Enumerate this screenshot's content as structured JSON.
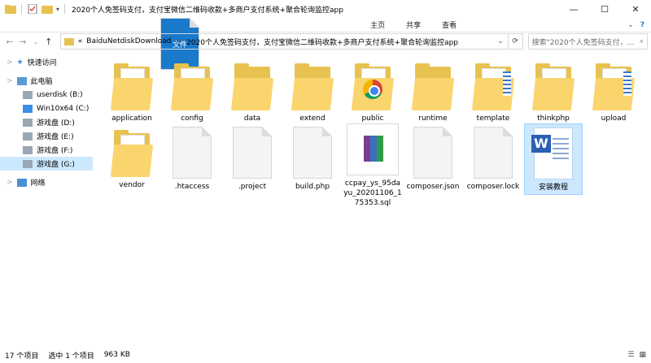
{
  "window": {
    "title": "2020个人免签码支付，支付宝微信二维码收款+多商户支付系统+聚合轮询监控app",
    "minimize_glyph": "—",
    "maximize_glyph": "☐",
    "close_glyph": "✕"
  },
  "ribbon": {
    "tabs": [
      "文件",
      "主页",
      "共享",
      "查看"
    ],
    "expand_glyph": "⌄",
    "help_glyph": "?"
  },
  "address": {
    "back_glyph": "←",
    "forward_glyph": "→",
    "recent_glyph": "⌄",
    "up_glyph": "↑",
    "overflow": "«",
    "crumbs": [
      "BaiduNetdiskDownload",
      "2020个人免签码支付，支付宝微信二维码收款+多商户支付系统+聚合轮询监控app"
    ],
    "separator": ">",
    "dropdown_glyph": "⌄",
    "refresh_glyph": "⟳",
    "search_placeholder": "搜索\"2020个人免签码支付，...",
    "search_glyph": "⌕"
  },
  "sidebar": {
    "items": [
      {
        "label": "快速访问",
        "icon": "star-icon"
      },
      {
        "label": "此电脑",
        "icon": "computer-icon"
      },
      {
        "label": "userdisk (B:)",
        "icon": "drive-icon"
      },
      {
        "label": "Win10x64 (C:)",
        "icon": "windows-drive-icon"
      },
      {
        "label": "游戏盘 (D:)",
        "icon": "drive-icon"
      },
      {
        "label": "游戏盘 (E:)",
        "icon": "drive-icon"
      },
      {
        "label": "游戏盘 (F:)",
        "icon": "drive-icon"
      },
      {
        "label": "游戏盘 (G:)",
        "icon": "drive-icon"
      },
      {
        "label": "网络",
        "icon": "network-icon"
      }
    ],
    "expand_glyph": ">"
  },
  "files": [
    {
      "name": "application",
      "type": "folder"
    },
    {
      "name": "config",
      "type": "folder"
    },
    {
      "name": "data",
      "type": "folder"
    },
    {
      "name": "extend",
      "type": "folder"
    },
    {
      "name": "public",
      "type": "folder-chrome"
    },
    {
      "name": "runtime",
      "type": "folder"
    },
    {
      "name": "template",
      "type": "folder-sheet"
    },
    {
      "name": "thinkphp",
      "type": "folder"
    },
    {
      "name": "upload",
      "type": "folder-sheet"
    },
    {
      "name": "vendor",
      "type": "folder"
    },
    {
      "name": ".htaccess",
      "type": "file"
    },
    {
      "name": ".project",
      "type": "file"
    },
    {
      "name": "build.php",
      "type": "file"
    },
    {
      "name": "ccpay_ys_95dayu_20201106_175353.sql",
      "type": "rar"
    },
    {
      "name": "composer.json",
      "type": "file"
    },
    {
      "name": "composer.lock",
      "type": "file"
    },
    {
      "name": "安装教程",
      "type": "word",
      "selected": true
    }
  ],
  "status": {
    "count": "17 个项目",
    "selected": "选中 1 个项目",
    "size": "963 KB",
    "details_view_glyph": "☰",
    "icons_view_glyph": "▦"
  },
  "colors": {
    "accent": "#1979ca",
    "selection": "#cce8ff",
    "folder": "#fad56d"
  }
}
